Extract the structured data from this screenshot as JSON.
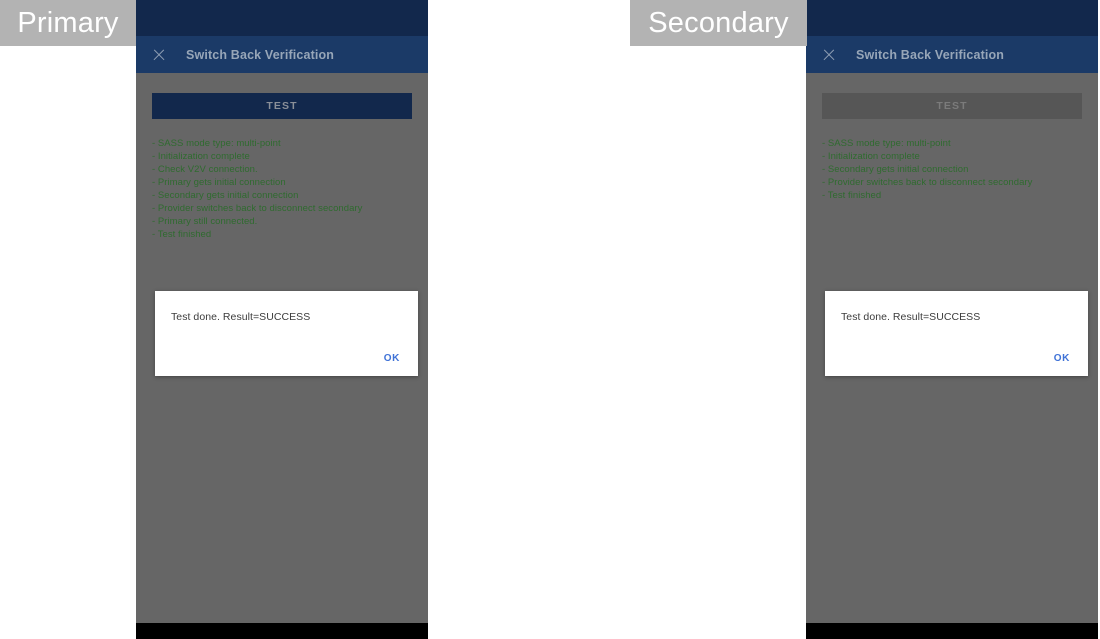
{
  "badges": {
    "primary": "Primary",
    "secondary": "Secondary"
  },
  "colors": {
    "status_bar": "#12284c",
    "app_bar": "#1b3a67",
    "panel_background": "#666666",
    "log_text": "#2f6b2f",
    "dialog_action": "#3f72d7",
    "badge_background": "#b3b3b3",
    "nav_bar": "#000000"
  },
  "primary_device": {
    "app_bar": {
      "close_icon": "close-icon",
      "title": "Switch Back Verification"
    },
    "test_button": {
      "label": "TEST",
      "state": "enabled"
    },
    "log_lines": [
      "- SASS mode type: multi-point",
      "- Initialization complete",
      "- Check V2V connection.",
      "- Primary gets initial connection",
      "- Secondary gets initial connection",
      "- Provider switches back to disconnect secondary",
      "- Primary still connected.",
      "- Test finished"
    ],
    "dialog": {
      "message": "Test done. Result=SUCCESS",
      "ok_label": "OK"
    }
  },
  "secondary_device": {
    "app_bar": {
      "close_icon": "close-icon",
      "title": "Switch Back Verification"
    },
    "test_button": {
      "label": "TEST",
      "state": "disabled"
    },
    "log_lines": [
      "- SASS mode type: multi-point",
      "- Initialization complete",
      "- Secondary gets initial connection",
      "- Provider switches back to disconnect secondary",
      "- Test finished"
    ],
    "dialog": {
      "message": "Test done. Result=SUCCESS",
      "ok_label": "OK"
    }
  }
}
